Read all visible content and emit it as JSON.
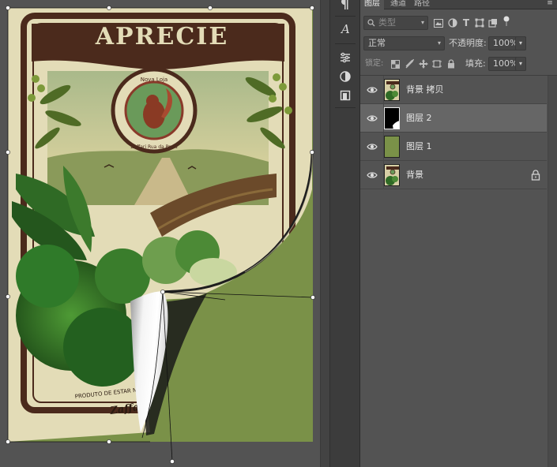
{
  "poster": {
    "title": "APRECIE",
    "seal_top": "Nova Loja",
    "seal_line": "Zaffari Rua da Praia",
    "bottom_text": "PRODUTO DE ESTAR NO",
    "brand_text": "Zaffari"
  },
  "tool_strip": {
    "icons": [
      "paragraph-icon",
      "character-icon",
      "adjustments-icon",
      "styles-icon",
      "properties-icon"
    ]
  },
  "layers_panel": {
    "tabs": [
      {
        "label": "图层",
        "active": true
      },
      {
        "label": "通道",
        "active": false
      },
      {
        "label": "路径",
        "active": false
      }
    ],
    "filter": {
      "placeholder": "类型"
    },
    "blend_mode": "正常",
    "opacity_label": "不透明度:",
    "opacity_value": "100%",
    "lock_label": "锁定:",
    "fill_label": "填充:",
    "fill_value": "100%",
    "layers": [
      {
        "name": "背景 拷贝",
        "thumb": "poster",
        "selected": false,
        "locked": false
      },
      {
        "name": "图层 2",
        "thumb": "mask",
        "selected": true,
        "locked": false
      },
      {
        "name": "图层 1",
        "thumb": "green",
        "selected": false,
        "locked": false
      },
      {
        "name": "背景",
        "thumb": "poster",
        "selected": false,
        "locked": true
      }
    ]
  },
  "colors": {
    "green_layer": "#7a9148",
    "poster_bg": "#e3dcb7",
    "poster_brown": "#4b2a1c",
    "selection": "#666666"
  }
}
